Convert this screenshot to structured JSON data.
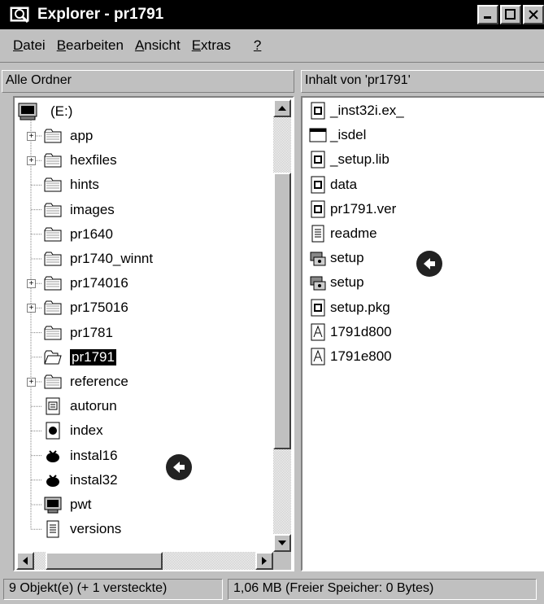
{
  "window": {
    "title": "Explorer - pr1791",
    "icon": "explorer-icon"
  },
  "menu": [
    {
      "label": "Datei",
      "accel": "D",
      "rest": "atei"
    },
    {
      "label": "Bearbeiten",
      "accel": "B",
      "rest": "earbeiten"
    },
    {
      "label": "Ansicht",
      "accel": "A",
      "rest": "nsicht"
    },
    {
      "label": "Extras",
      "accel": "E",
      "rest": "xtras"
    },
    {
      "label": "?",
      "accel": "?",
      "rest": ""
    }
  ],
  "left_header": "Alle Ordner",
  "right_header": "Inhalt von 'pr1791'",
  "tree": {
    "root": "(E:)",
    "items": [
      {
        "label": "app",
        "type": "folder",
        "expandable": true
      },
      {
        "label": "hexfiles",
        "type": "folder",
        "expandable": true
      },
      {
        "label": "hints",
        "type": "folder",
        "expandable": false
      },
      {
        "label": "images",
        "type": "folder",
        "expandable": false
      },
      {
        "label": "pr1640",
        "type": "folder",
        "expandable": false
      },
      {
        "label": "pr1740_winnt",
        "type": "folder",
        "expandable": false
      },
      {
        "label": "pr174016",
        "type": "folder",
        "expandable": true
      },
      {
        "label": "pr175016",
        "type": "folder",
        "expandable": true
      },
      {
        "label": "pr1781",
        "type": "folder",
        "expandable": false
      },
      {
        "label": "pr1791",
        "type": "folder-open",
        "expandable": false,
        "selected": true
      },
      {
        "label": "reference",
        "type": "folder",
        "expandable": true
      },
      {
        "label": "autorun",
        "type": "file",
        "icon": "ini-file-icon"
      },
      {
        "label": "index",
        "type": "file",
        "icon": "web-file-icon"
      },
      {
        "label": "instal16",
        "type": "file",
        "icon": "installer-icon"
      },
      {
        "label": "instal32",
        "type": "file",
        "icon": "installer-icon"
      },
      {
        "label": "pwt",
        "type": "file",
        "icon": "app-file-icon"
      },
      {
        "label": "versions",
        "type": "file",
        "icon": "text-file-icon"
      }
    ]
  },
  "files": [
    {
      "label": "_inst32i.ex_",
      "icon": "exe-file-icon"
    },
    {
      "label": "_isdel",
      "icon": "window-file-icon"
    },
    {
      "label": "_setup.lib",
      "icon": "exe-file-icon"
    },
    {
      "label": "data",
      "icon": "exe-file-icon"
    },
    {
      "label": "pr1791.ver",
      "icon": "exe-file-icon"
    },
    {
      "label": "readme",
      "icon": "text-file-icon"
    },
    {
      "label": "setup",
      "icon": "setup-icon"
    },
    {
      "label": "setup",
      "icon": "setup-icon"
    },
    {
      "label": "setup.pkg",
      "icon": "exe-file-icon"
    },
    {
      "label": "1791d800",
      "icon": "pdf-file-icon"
    },
    {
      "label": "1791e800",
      "icon": "pdf-file-icon"
    }
  ],
  "status": {
    "objects": "9 Objekt(e) (+ 1 versteckte)",
    "size": "1,06 MB (Freier Speicher: 0 Bytes)"
  }
}
